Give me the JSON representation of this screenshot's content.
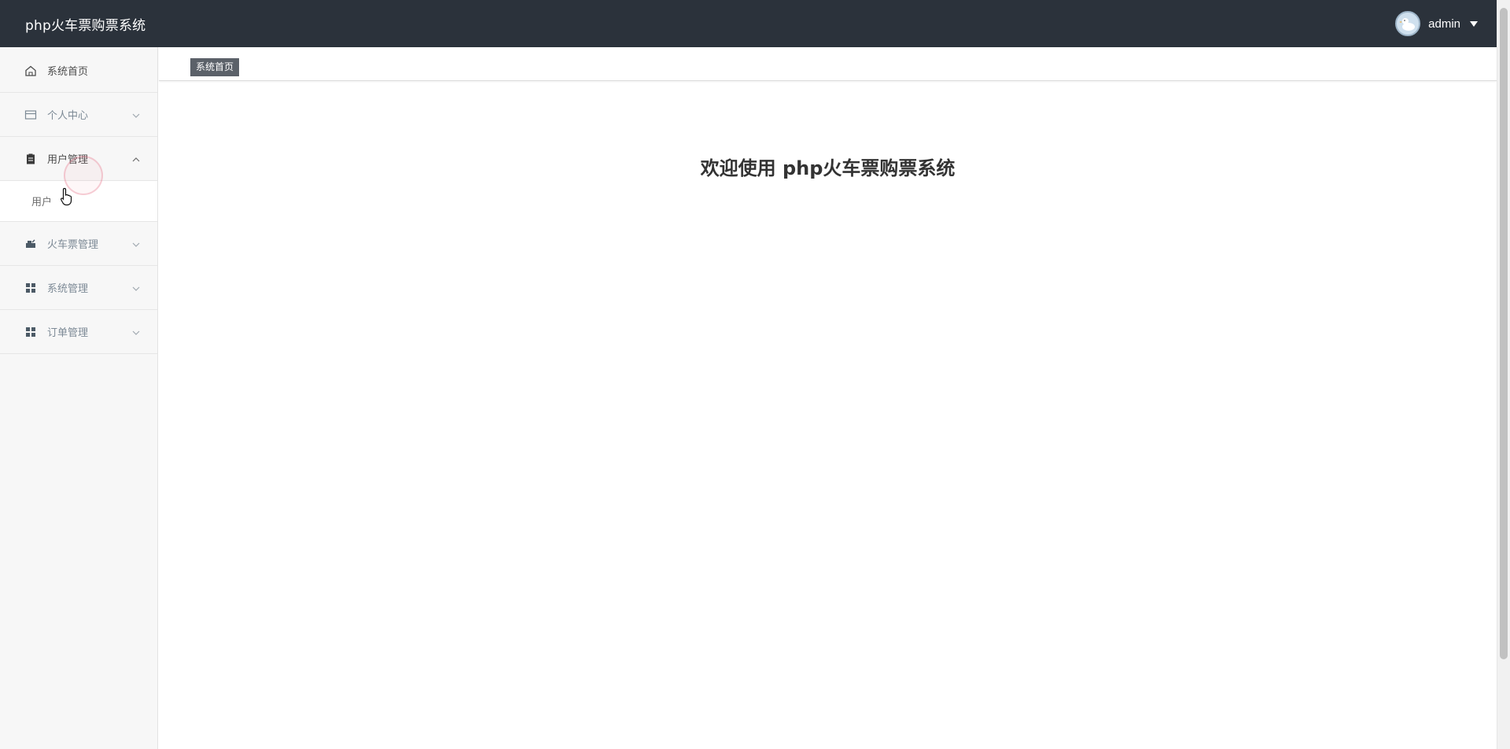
{
  "header": {
    "app_title": "php火车票购票系统",
    "user_name": "admin",
    "icons": [
      "avatar",
      "caret-down-icon"
    ]
  },
  "sidebar": {
    "items": [
      {
        "label": "系统首页",
        "icon": "home-icon",
        "expanded": false
      },
      {
        "label": "个人中心",
        "icon": "card-icon",
        "expanded": false
      },
      {
        "label": "用户管理",
        "icon": "clipboard-icon",
        "expanded": true,
        "children": [
          {
            "label": "用户"
          }
        ]
      },
      {
        "label": "火车票管理",
        "icon": "ticket-icon",
        "expanded": false
      },
      {
        "label": "系统管理",
        "icon": "grid-icon",
        "expanded": false
      },
      {
        "label": "订单管理",
        "icon": "grid-icon",
        "expanded": false
      }
    ]
  },
  "tabs": [
    {
      "label": "系统首页",
      "active": true
    }
  ],
  "main": {
    "welcome": "欢迎使用 php火车票购票系统"
  },
  "colors": {
    "topbar": "#2b323b",
    "sidebar": "#f7f7f7",
    "tag": "#5b6169"
  }
}
